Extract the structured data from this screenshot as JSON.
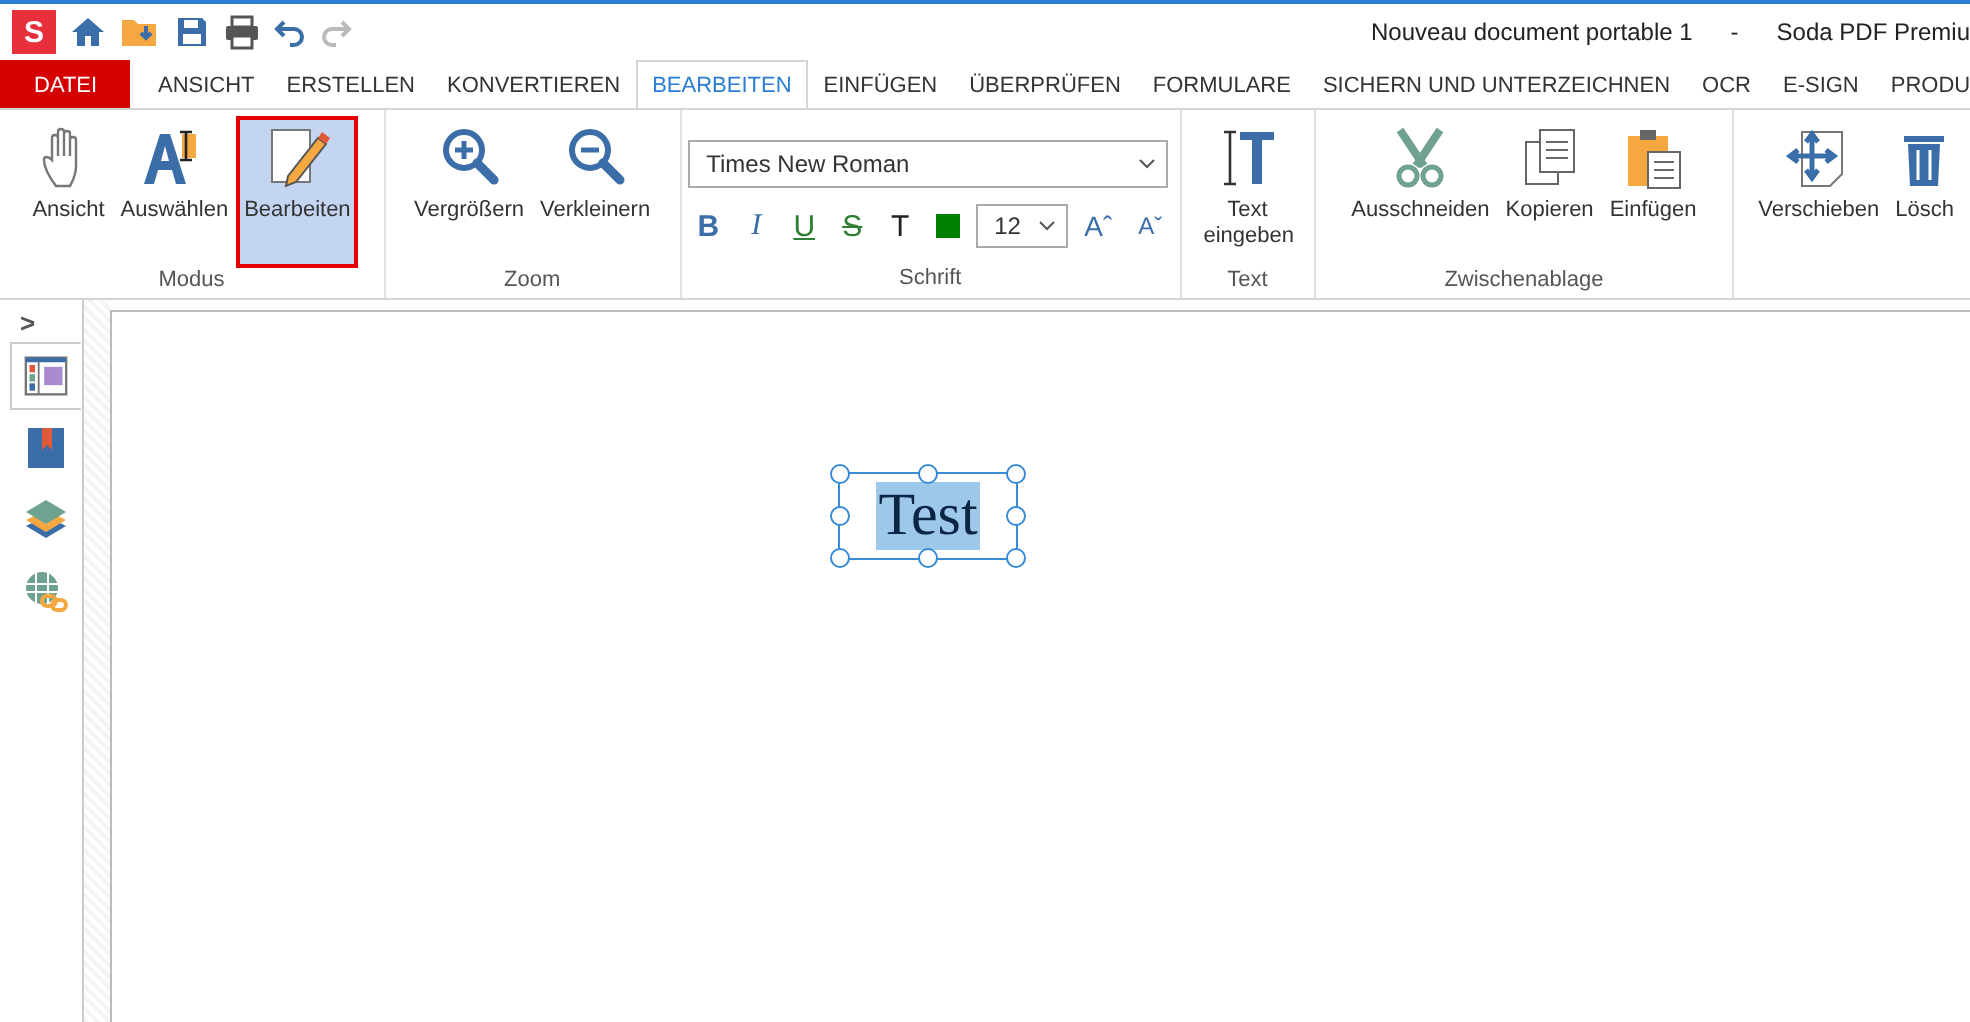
{
  "title_bar": {
    "document": "Nouveau document portable 1",
    "separator": "-",
    "app": "Soda PDF Premiu",
    "logo": "S"
  },
  "tabs": [
    {
      "label": "DATEI",
      "kind": "file",
      "selected": false
    },
    {
      "label": "ANSICHT",
      "kind": "tab",
      "selected": false
    },
    {
      "label": "ERSTELLEN",
      "kind": "tab",
      "selected": false
    },
    {
      "label": "KONVERTIEREN",
      "kind": "tab",
      "selected": false
    },
    {
      "label": "BEARBEITEN",
      "kind": "tab",
      "selected": true
    },
    {
      "label": "EINFÜGEN",
      "kind": "tab",
      "selected": false
    },
    {
      "label": "ÜBERPRÜFEN",
      "kind": "tab",
      "selected": false
    },
    {
      "label": "FORMULARE",
      "kind": "tab",
      "selected": false
    },
    {
      "label": "SICHERN UND UNTERZEICHNEN",
      "kind": "tab",
      "selected": false
    },
    {
      "label": "OCR",
      "kind": "tab",
      "selected": false
    },
    {
      "label": "E-SIGN",
      "kind": "tab",
      "selected": false
    },
    {
      "label": "PRODU",
      "kind": "tab",
      "selected": false
    }
  ],
  "ribbon": {
    "modus": {
      "label": "Modus",
      "buttons": [
        {
          "label": "Ansicht",
          "selected": false
        },
        {
          "label": "Auswählen",
          "selected": false
        },
        {
          "label": "Bearbeiten",
          "selected": true
        }
      ]
    },
    "zoom": {
      "label": "Zoom",
      "buttons": [
        {
          "label": "Vergrößern"
        },
        {
          "label": "Verkleinern"
        }
      ]
    },
    "schrift": {
      "label": "Schrift",
      "font": "Times New Roman",
      "size": "12",
      "format_buttons": [
        {
          "label": "B"
        },
        {
          "label": "I"
        },
        {
          "label": "U"
        },
        {
          "label": "S"
        },
        {
          "label": "T"
        }
      ],
      "color": "#008000",
      "grow": "Aˆ",
      "shrink": "Aˇ"
    },
    "text": {
      "label": "Text",
      "buttons": [
        {
          "label": "Text eingeben"
        }
      ]
    },
    "zwischenablage": {
      "label": "Zwischenablage",
      "buttons": [
        {
          "label": "Ausschneiden"
        },
        {
          "label": "Kopieren"
        },
        {
          "label": "Einfügen"
        }
      ]
    },
    "more": {
      "buttons": [
        {
          "label": "Verschieben"
        },
        {
          "label": "Lösch"
        }
      ]
    }
  },
  "sidebar": {
    "expand": ">",
    "items": [
      {
        "selected": true
      },
      {
        "selected": false
      },
      {
        "selected": false
      },
      {
        "selected": false
      }
    ]
  },
  "document": {
    "text": "Test",
    "selected": true
  }
}
